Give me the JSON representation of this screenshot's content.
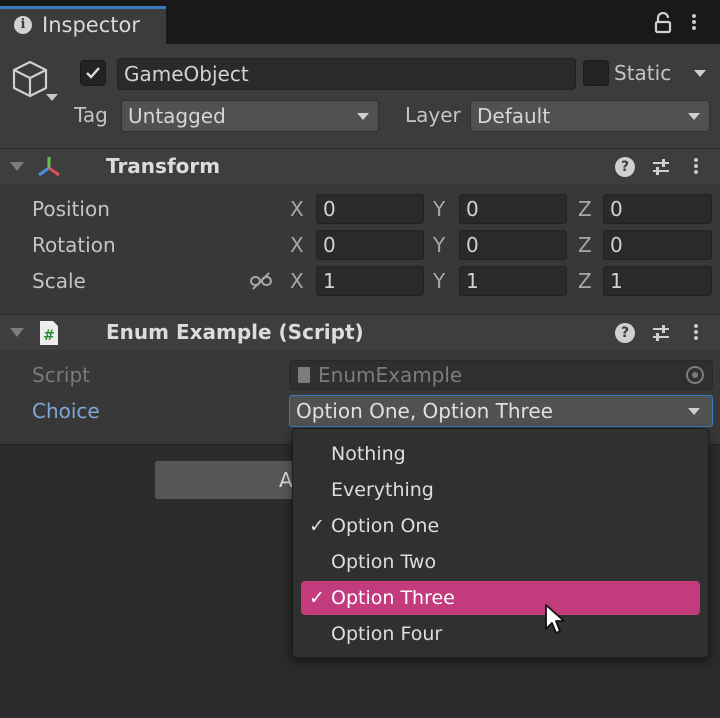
{
  "tab": {
    "title": "Inspector",
    "info_icon": "info-icon"
  },
  "gameobject": {
    "active": true,
    "name": "GameObject",
    "static_label": "Static",
    "static": false,
    "tag_label": "Tag",
    "tag_value": "Untagged",
    "layer_label": "Layer",
    "layer_value": "Default"
  },
  "transform": {
    "title": "Transform",
    "rows": [
      {
        "label": "Position",
        "x": "0",
        "y": "0",
        "z": "0"
      },
      {
        "label": "Rotation",
        "x": "0",
        "y": "0",
        "z": "0"
      },
      {
        "label": "Scale",
        "x": "1",
        "y": "1",
        "z": "1"
      }
    ],
    "axis": {
      "x": "X",
      "y": "Y",
      "z": "Z"
    }
  },
  "script_component": {
    "title": "Enum Example (Script)",
    "script_label": "Script",
    "script_value": "EnumExample",
    "choice_label": "Choice",
    "choice_value": "Option One, Option Three"
  },
  "add_component": {
    "label": "A"
  },
  "dropdown": {
    "options": [
      {
        "label": "Nothing",
        "checked": false,
        "highlighted": false
      },
      {
        "label": "Everything",
        "checked": false,
        "highlighted": false
      },
      {
        "label": "Option One",
        "checked": true,
        "highlighted": false
      },
      {
        "label": "Option Two",
        "checked": false,
        "highlighted": false
      },
      {
        "label": "Option Three",
        "checked": true,
        "highlighted": true
      },
      {
        "label": "Option Four",
        "checked": false,
        "highlighted": false
      }
    ],
    "check_glyph": "✓"
  },
  "colors": {
    "highlight": "#c23b7d",
    "accent": "#3b7bc2",
    "choice_label": "#7fa7d8"
  }
}
